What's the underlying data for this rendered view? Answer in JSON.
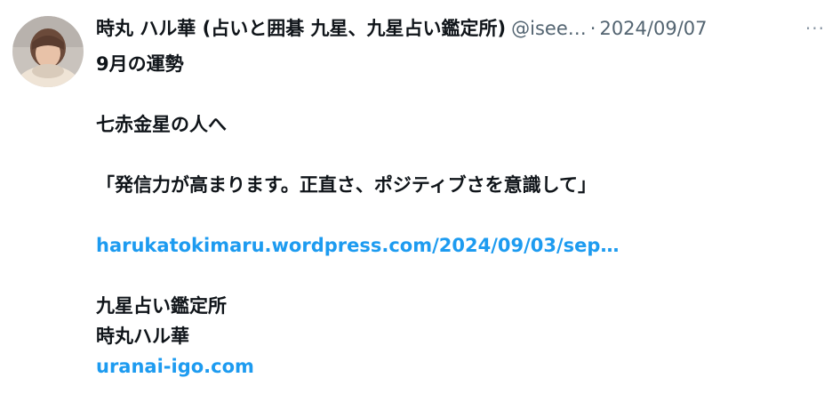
{
  "header": {
    "display_name": "時丸 ハル華 (占いと囲碁 九星、九星占い鑑定所)",
    "handle": "@isee…",
    "separator": "·",
    "date": "2024/09/07",
    "more_label": "···"
  },
  "body": {
    "line_1": "9月の運勢",
    "line_2": "七赤金星の人へ",
    "line_3": "「発信力が高まります。正直さ、ポジティブさを意識して」",
    "link_1": "harukatokimaru.wordpress.com/2024/09/03/sep…",
    "line_4": "九星占い鑑定所",
    "line_5": "時丸ハル華",
    "link_2": "uranai-igo.com"
  },
  "colors": {
    "text": "#0f1419",
    "secondary": "#536471",
    "link": "#1d9bf0"
  }
}
